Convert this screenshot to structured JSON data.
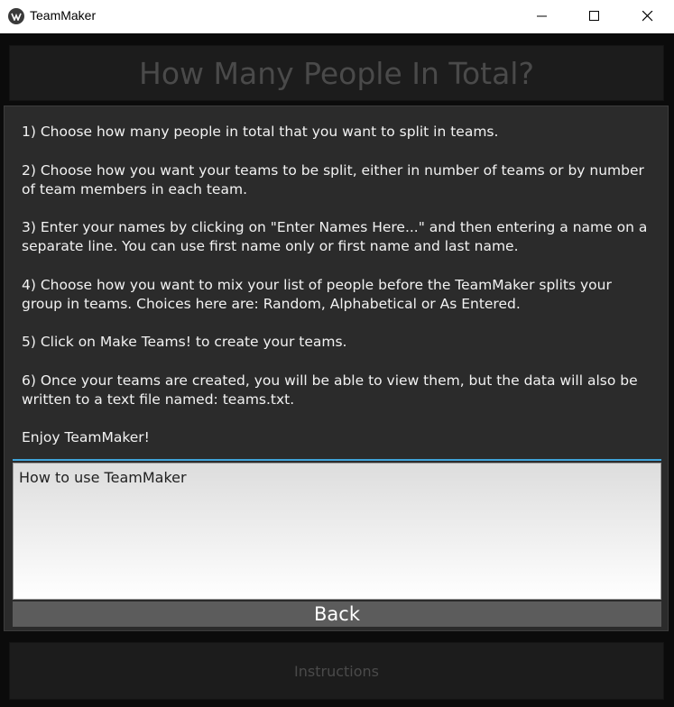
{
  "window": {
    "title": "TeamMaker"
  },
  "header": {
    "title": "How Many People In Total?"
  },
  "instructions": {
    "paragraphs": [
      "1) Choose how many people in total that you want to split in teams.",
      "2) Choose how you want your teams to be split, either in number of teams or by number of team members in each team.",
      "3) Enter your names by clicking on \"Enter Names Here...\" and then entering a name on a separate line. You can use first name only or first name and last name.",
      "4) Choose how you want to mix your list of people before the TeamMaker splits your group in teams. Choices here are: Random, Alphabetical or As Entered.",
      "5) Click on Make Teams! to create your teams.",
      "6) Once your teams are created, you will be able to view them, but the data will also be written to a text file named: teams.txt.",
      "Enjoy TeamMaker!"
    ]
  },
  "textbox": {
    "value": "How to use TeamMaker"
  },
  "buttons": {
    "back": "Back",
    "instructions": "Instructions"
  },
  "colors": {
    "accent": "#3fa3d9",
    "panel": "#2b2b2b",
    "button": "#5c5c5c"
  },
  "icons": {
    "app": "kivy-logo-icon",
    "minimize": "minimize-icon",
    "maximize": "maximize-icon",
    "close": "close-icon"
  }
}
